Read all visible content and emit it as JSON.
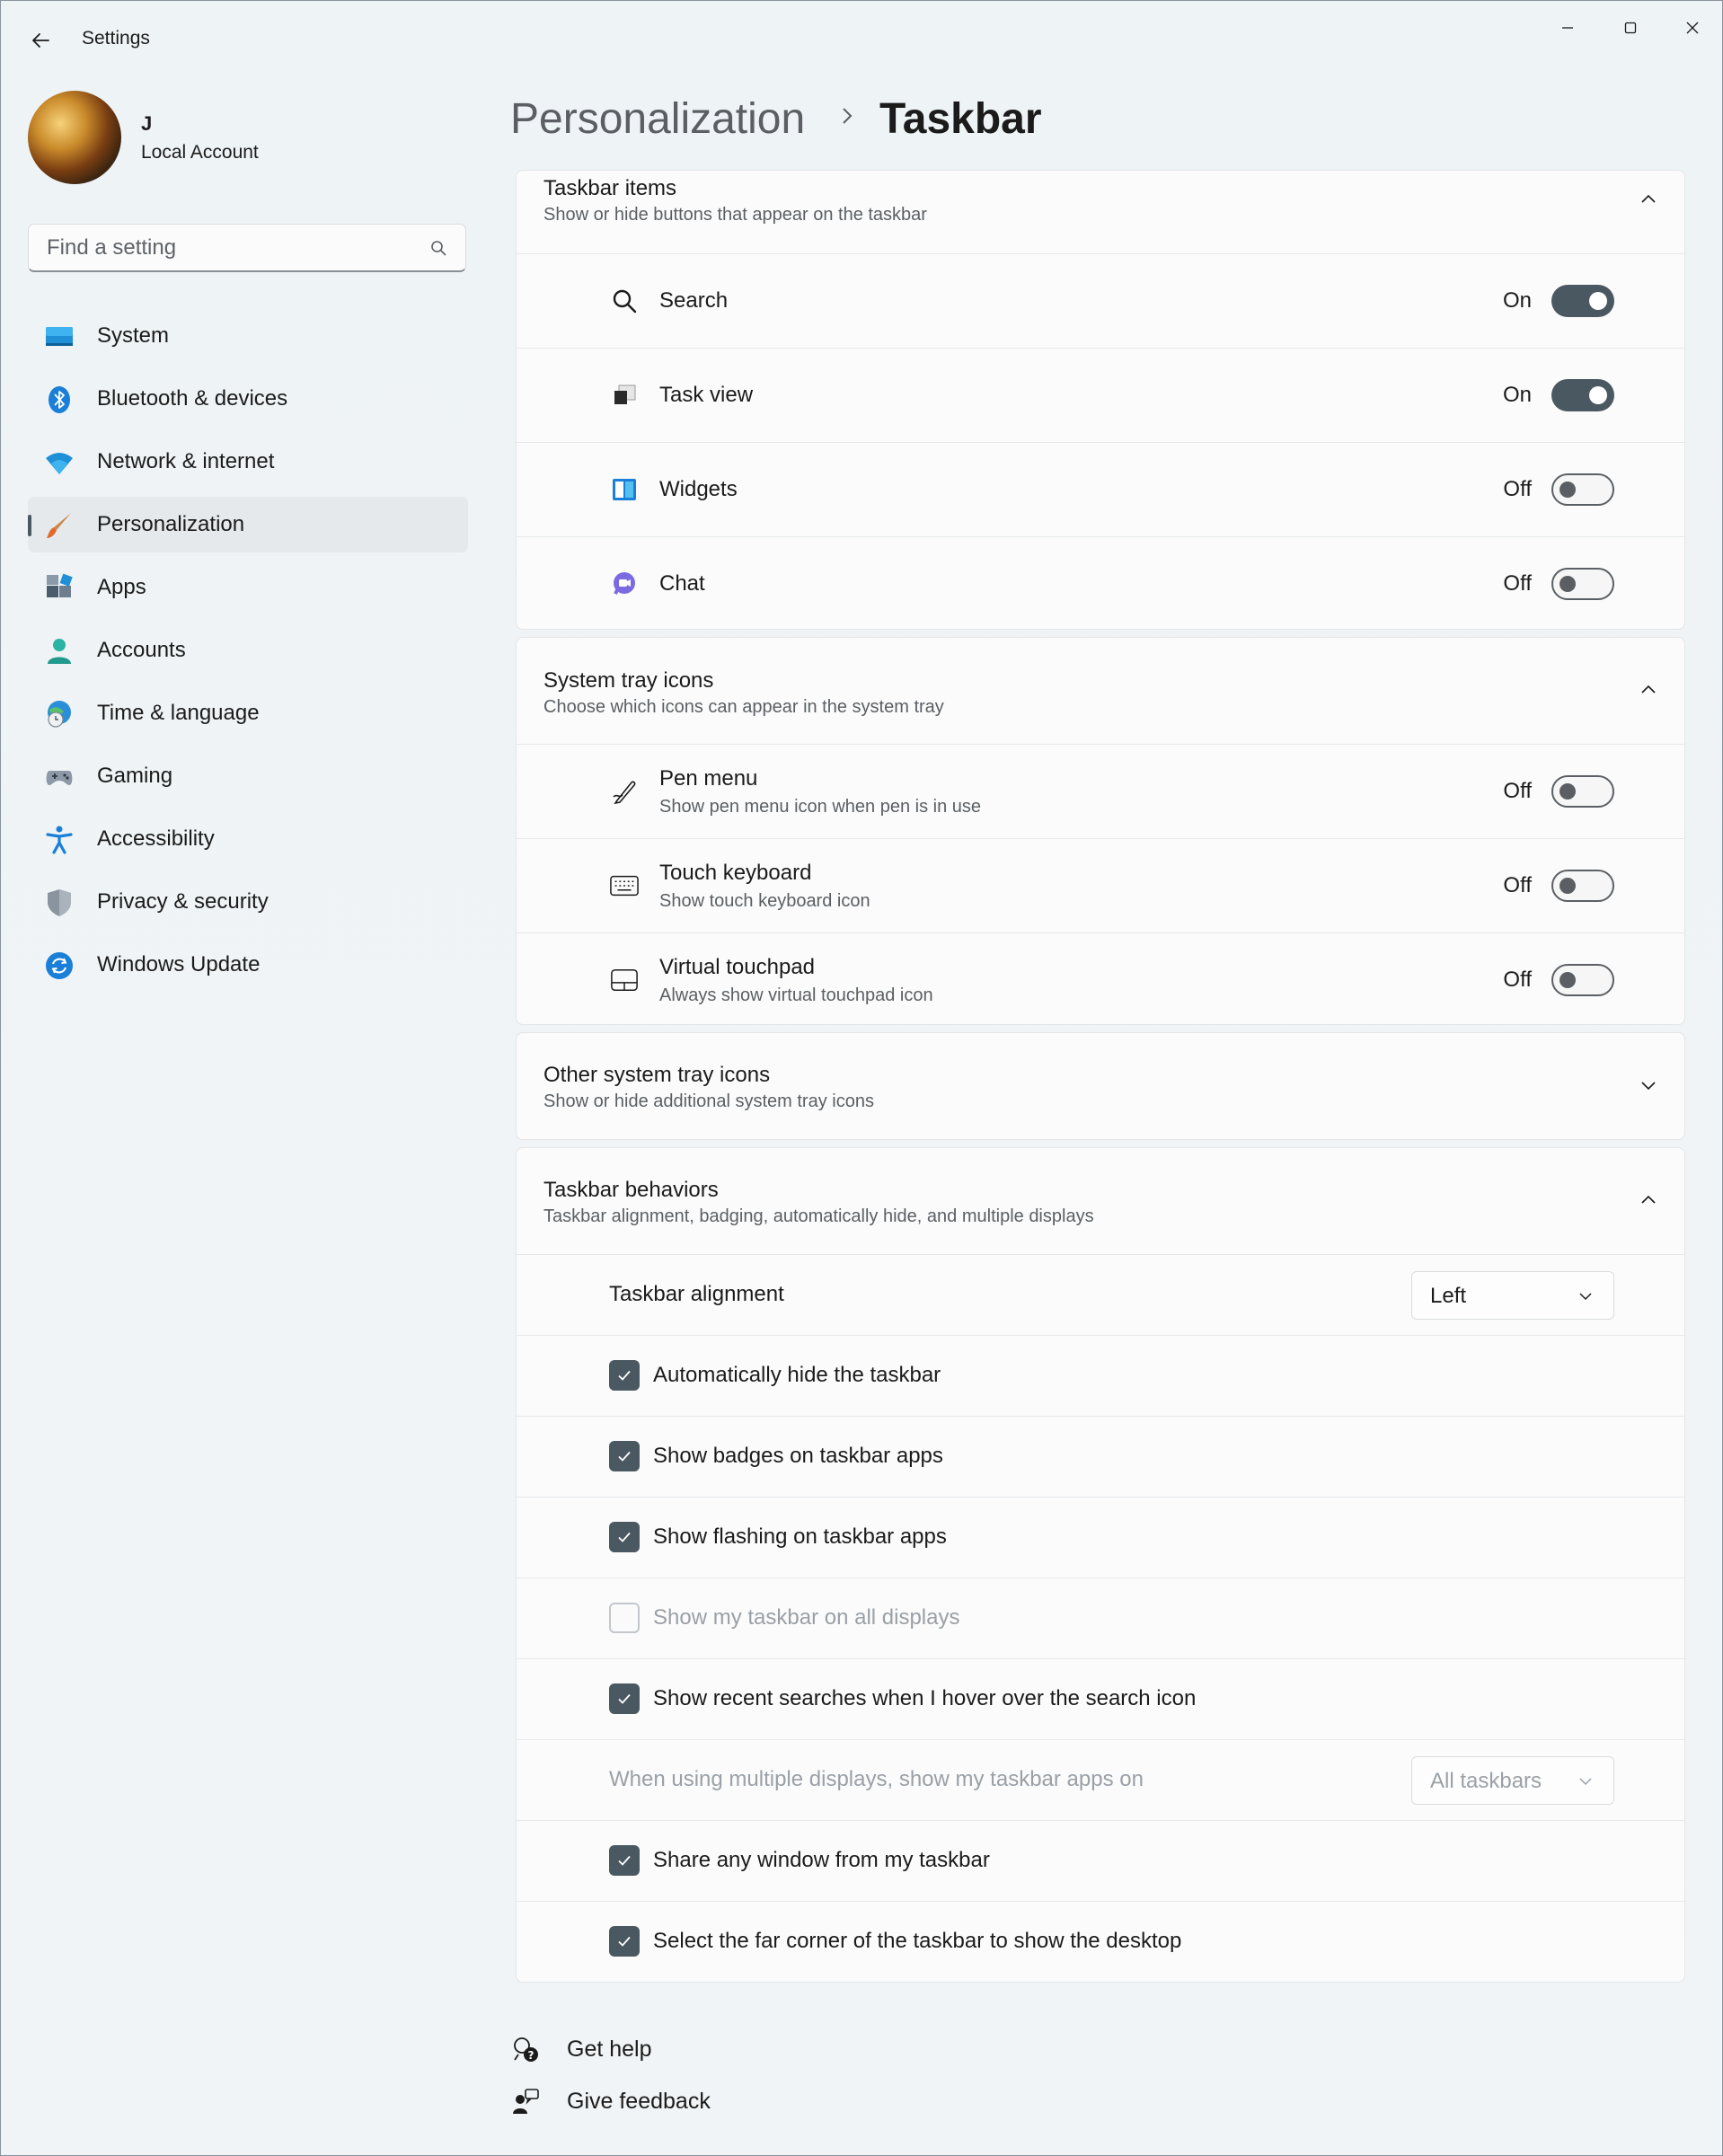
{
  "window": {
    "title": "Settings"
  },
  "profile": {
    "name": "J",
    "account_type": "Local Account"
  },
  "search": {
    "placeholder": "Find a setting"
  },
  "sidebar": {
    "items": [
      {
        "label": "System",
        "icon": "system-icon"
      },
      {
        "label": "Bluetooth & devices",
        "icon": "bluetooth-icon"
      },
      {
        "label": "Network & internet",
        "icon": "wifi-icon"
      },
      {
        "label": "Personalization",
        "icon": "brush-icon",
        "active": true
      },
      {
        "label": "Apps",
        "icon": "apps-icon"
      },
      {
        "label": "Accounts",
        "icon": "person-icon"
      },
      {
        "label": "Time & language",
        "icon": "globe-clock-icon"
      },
      {
        "label": "Gaming",
        "icon": "gamepad-icon"
      },
      {
        "label": "Accessibility",
        "icon": "accessibility-icon"
      },
      {
        "label": "Privacy & security",
        "icon": "shield-icon"
      },
      {
        "label": "Windows Update",
        "icon": "update-icon"
      }
    ]
  },
  "header": {
    "parent": "Personalization",
    "separator": "›",
    "current": "Taskbar"
  },
  "taskbar_items": {
    "title": "Taskbar items",
    "subtitle": "Show or hide buttons that appear on the taskbar",
    "rows": [
      {
        "label": "Search",
        "state": "On",
        "icon": "search-icon"
      },
      {
        "label": "Task view",
        "state": "On",
        "icon": "task-view-icon"
      },
      {
        "label": "Widgets",
        "state": "Off",
        "icon": "widgets-icon"
      },
      {
        "label": "Chat",
        "state": "Off",
        "icon": "chat-icon"
      }
    ]
  },
  "system_tray": {
    "title": "System tray icons",
    "subtitle": "Choose which icons can appear in the system tray",
    "rows": [
      {
        "label": "Pen menu",
        "sub": "Show pen menu icon when pen is in use",
        "state": "Off",
        "icon": "pen-icon"
      },
      {
        "label": "Touch keyboard",
        "sub": "Show touch keyboard icon",
        "state": "Off",
        "icon": "keyboard-icon"
      },
      {
        "label": "Virtual touchpad",
        "sub": "Always show virtual touchpad icon",
        "state": "Off",
        "icon": "touchpad-icon"
      }
    ]
  },
  "other_tray": {
    "title": "Other system tray icons",
    "subtitle": "Show or hide additional system tray icons"
  },
  "behaviors": {
    "title": "Taskbar behaviors",
    "subtitle": "Taskbar alignment, badging, automatically hide, and multiple displays",
    "alignment_label": "Taskbar alignment",
    "alignment_value": "Left",
    "auto_hide": {
      "label": "Automatically hide the taskbar",
      "checked": true
    },
    "badges": {
      "label": "Show badges on taskbar apps",
      "checked": true
    },
    "flashing": {
      "label": "Show flashing on taskbar apps",
      "checked": true
    },
    "all_displays": {
      "label": "Show my taskbar on all displays",
      "checked": false,
      "disabled": true
    },
    "recent_searches": {
      "label": "Show recent searches when I hover over the search icon",
      "checked": true
    },
    "multi_display_label": "When using multiple displays, show my taskbar apps on",
    "multi_display_value": "All taskbars",
    "share_window": {
      "label": "Share any window from my taskbar",
      "checked": true
    },
    "far_corner": {
      "label": "Select the far corner of the taskbar to show the desktop",
      "checked": true
    }
  },
  "footer": {
    "help": "Get help",
    "feedback": "Give feedback"
  },
  "colors": {
    "accent": "#4a5862",
    "background": "#eef2f5",
    "card": "#fbfbfb"
  }
}
